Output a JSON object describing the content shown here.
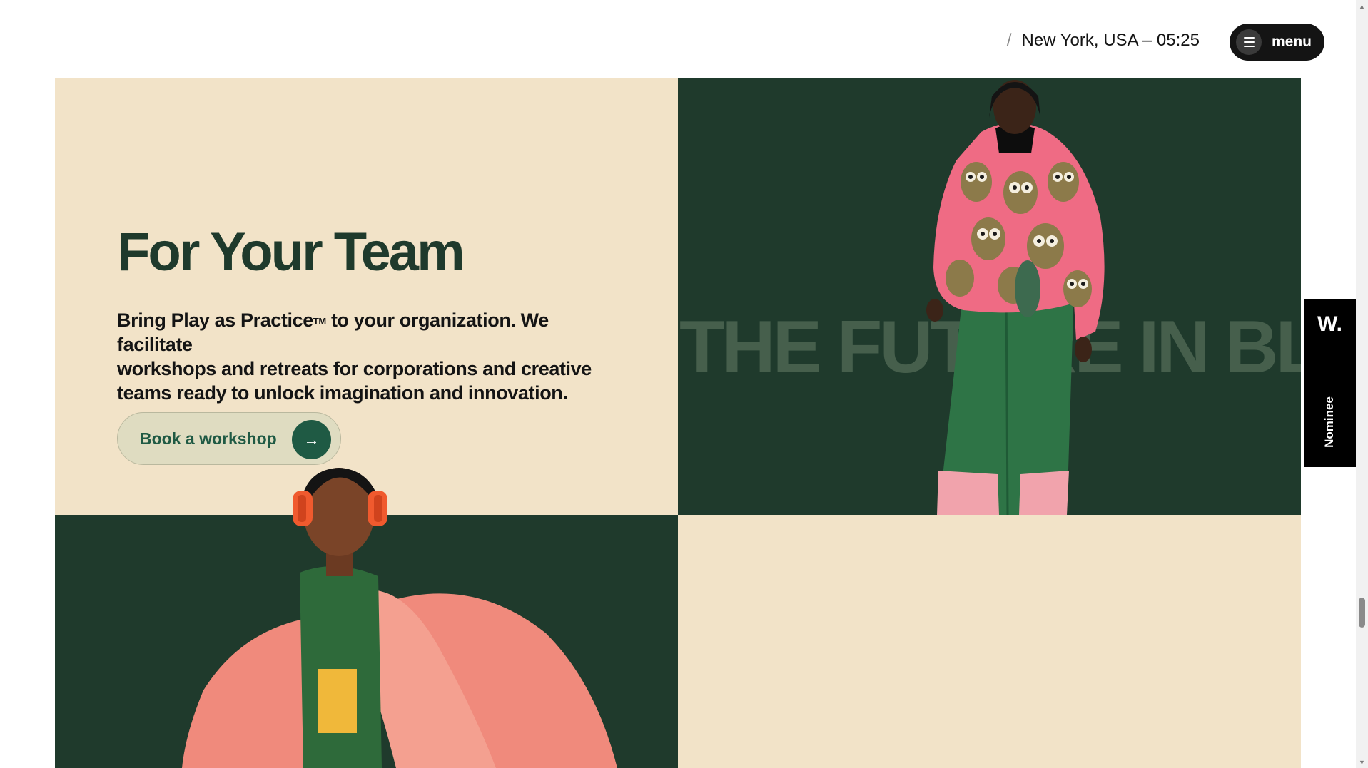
{
  "header": {
    "location_separator": "/",
    "location_text": "New York, USA – 05:25",
    "menu_label": "menu"
  },
  "team": {
    "title": "For Your Team",
    "body_line_1_start": "Bring Play as Practice",
    "trademark": "TM",
    "body_line_1_end": " to your organization. We facilitate",
    "body_line_2": "workshops and retreats for corporations and creative",
    "body_line_3": "teams ready to unlock imagination and innovation.",
    "cta_label": "Book a workshop",
    "cta_arrow": "→"
  },
  "marquee": {
    "text": "THE FUTURE IN BLA"
  },
  "award": {
    "logo": "W.",
    "label": "Nominee"
  },
  "colors": {
    "cream": "#f2e3c8",
    "forest": "#1f3a2c",
    "accent_green": "#1f5a44",
    "coral": "#f08a7c",
    "pink": "#e6587a",
    "black": "#141414"
  },
  "icons": {
    "menu": "hamburger-icon",
    "cta": "arrow-right-icon",
    "scroll_up": "triangle-up-icon",
    "scroll_down": "triangle-down-icon"
  },
  "images": {
    "figure_right": "person in pink owl-pattern sweater and green trousers",
    "figure_left": "person with orange headphones and coral fur coat"
  }
}
